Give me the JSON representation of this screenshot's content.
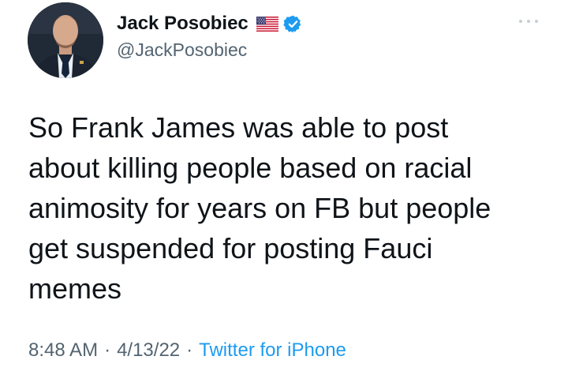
{
  "author": {
    "display_name": "Jack Posobiec",
    "handle": "@JackPosobiec",
    "flag_icon": "us-flag-icon",
    "verified_icon": "verified-badge-icon",
    "verified_color": "#1d9bf0"
  },
  "tweet": {
    "text": "So Frank James was able to post\nabout killing people based on racial\nanimosity for years on FB but people\nget suspended for posting Fauci\nmemes"
  },
  "meta": {
    "time": "8:48 AM",
    "separator": "·",
    "date": "4/13/22",
    "source": "Twitter for iPhone",
    "source_color": "#1d9bf0"
  },
  "more_icon": "more-options-icon"
}
